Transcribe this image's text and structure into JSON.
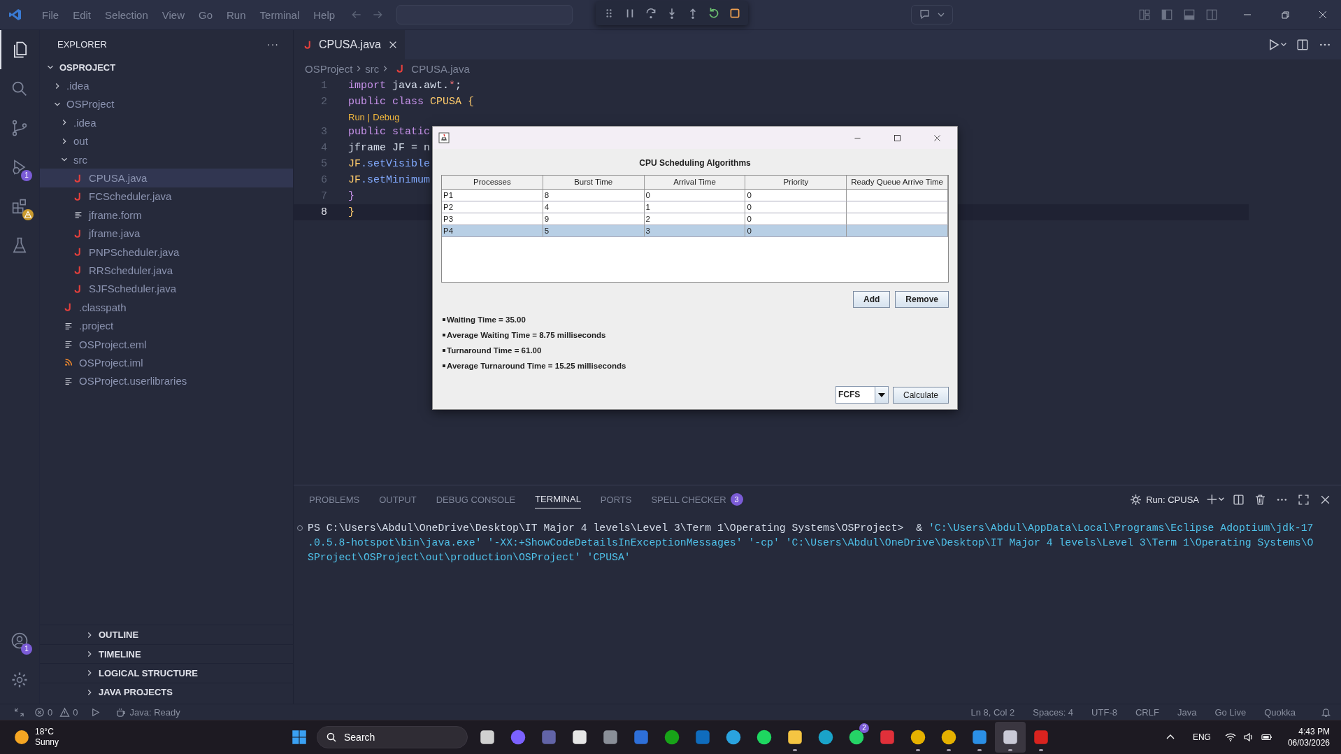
{
  "menu": [
    "File",
    "Edit",
    "Selection",
    "View",
    "Go",
    "Run",
    "Terminal",
    "Help"
  ],
  "activity": [
    {
      "kind": "files",
      "selected": true
    },
    {
      "kind": "search",
      "selected": false
    },
    {
      "kind": "branch",
      "selected": false
    },
    {
      "kind": "debug",
      "selected": false,
      "badge": "1"
    },
    {
      "kind": "extensions",
      "selected": false,
      "warning": true
    },
    {
      "kind": "flask",
      "selected": false
    }
  ],
  "activity_bottom": [
    {
      "kind": "account",
      "badge": "1"
    },
    {
      "kind": "gear"
    }
  ],
  "explorer": {
    "title": "EXPLORER",
    "menu": "···",
    "root": {
      "label": "OSPROJECT",
      "expanded": true,
      "children": [
        {
          "label": ".idea",
          "expanded": false,
          "selected": false
        },
        {
          "label": "OSProject",
          "expanded": true,
          "selected": false,
          "children": [
            {
              "label": ".idea",
              "expanded": false,
              "selected": false
            },
            {
              "label": "out",
              "expanded": false,
              "selected": false
            },
            {
              "label": "src",
              "expanded": true,
              "selected": false,
              "children": [
                {
                  "label": "CPUSA.java",
                  "kind": "java",
                  "selected": true
                },
                {
                  "label": "FCScheduler.java",
                  "kind": "java",
                  "selected": false
                },
                {
                  "label": "jframe.form",
                  "kind": "lines",
                  "selected": false
                },
                {
                  "label": "jframe.java",
                  "kind": "java",
                  "selected": false
                },
                {
                  "label": "PNPScheduler.java",
                  "kind": "java",
                  "selected": false
                },
                {
                  "label": "RRScheduler.java",
                  "kind": "java",
                  "selected": false
                },
                {
                  "label": "SJFScheduler.java",
                  "kind": "java",
                  "selected": false
                }
              ]
            },
            {
              "label": ".classpath",
              "kind": "java",
              "selected": false
            },
            {
              "label": ".project",
              "kind": "lines",
              "selected": false
            },
            {
              "label": "OSProject.eml",
              "kind": "lines",
              "selected": false
            },
            {
              "label": "OSProject.iml",
              "kind": "rss",
              "selected": false
            },
            {
              "label": "OSProject.userlibraries",
              "kind": "lines",
              "selected": false
            }
          ]
        }
      ]
    }
  },
  "sections": [
    {
      "label": "OUTLINE",
      "expanded": false
    },
    {
      "label": "TIMELINE",
      "expanded": false
    },
    {
      "label": "LOGICAL STRUCTURE",
      "expanded": false
    },
    {
      "label": "JAVA PROJECTS",
      "expanded": false
    }
  ],
  "editor": {
    "tab": "CPUSA.java",
    "breadcrumbs": [
      "OSProject",
      "src",
      "CPUSA.java"
    ],
    "lines": [
      {
        "num": "1",
        "current": false,
        "tokens": [
          {
            "t": "import",
            "kind": "keyword"
          },
          {
            "t": " java.awt.",
            "kind": "plain"
          },
          {
            "t": "*",
            "kind": "operator"
          },
          {
            "t": ";",
            "kind": "plain"
          }
        ]
      },
      {
        "num": "2",
        "current": false,
        "tokens": [
          {
            "t": "public class ",
            "kind": "keyword"
          },
          {
            "t": "CPUSA",
            "kind": "type"
          },
          {
            "t": " {",
            "kind": "type"
          }
        ],
        "lens": [
          "Run",
          "|",
          "Debug"
        ]
      },
      {
        "num": "3",
        "current": false,
        "tokens": [
          {
            "t": "public static",
            "kind": "keyword"
          }
        ]
      },
      {
        "num": "4",
        "current": false,
        "tokens": [
          {
            "t": "jframe JF = n",
            "kind": "plain"
          }
        ]
      },
      {
        "num": "5",
        "current": false,
        "tokens": [
          {
            "t": "JF",
            "kind": "type"
          },
          {
            "t": ".setVisible",
            "kind": "method"
          }
        ]
      },
      {
        "num": "6",
        "current": false,
        "tokens": [
          {
            "t": "JF",
            "kind": "type"
          },
          {
            "t": ".setMinimum",
            "kind": "method"
          }
        ]
      },
      {
        "num": "7",
        "current": false,
        "tokens": [
          {
            "t": "}",
            "kind": "keyword"
          }
        ]
      },
      {
        "num": "8",
        "current": true,
        "tokens": [
          {
            "t": "}",
            "kind": "type"
          }
        ]
      }
    ]
  },
  "dialog": {
    "heading": "CPU Scheduling Algorithms",
    "columns": [
      "Processes",
      "Burst Time",
      "Arrival Time",
      "Priority",
      "Ready Queue Arrive Time"
    ],
    "rows": [
      {
        "cells": [
          "P1",
          "8",
          "0",
          "0"
        ],
        "selected": false
      },
      {
        "cells": [
          "P2",
          "4",
          "1",
          "0"
        ],
        "selected": false
      },
      {
        "cells": [
          "P3",
          "9",
          "2",
          "0"
        ],
        "selected": false
      },
      {
        "cells": [
          "P4",
          "5",
          "3",
          "0"
        ],
        "selected": true
      }
    ],
    "buttons": [
      "Add",
      "Remove"
    ],
    "results": [
      "Waiting Time = 35.00",
      "Average Waiting Time = 8.75 milliseconds",
      "Turnaround Time = 61.00",
      "Average Turnaround Time = 15.25 milliseconds"
    ],
    "algorithm": "FCFS",
    "calculate": "Calculate"
  },
  "panel": {
    "tabs": [
      {
        "label": "PROBLEMS",
        "selected": false
      },
      {
        "label": "OUTPUT",
        "selected": false
      },
      {
        "label": "DEBUG CONSOLE",
        "selected": false
      },
      {
        "label": "TERMINAL",
        "selected": true
      },
      {
        "label": "PORTS",
        "selected": false
      },
      {
        "label": "SPELL CHECKER",
        "selected": false,
        "badge": "3"
      }
    ],
    "run_label": "Run: CPUSA",
    "terminal": [
      [
        {
          "t": "PS C:\\Users\\Abdul\\OneDrive\\Desktop\\IT Major 4 levels\\Level 3\\Term 1\\Operating Systems\\OSProject>  & ",
          "kind": "plain"
        },
        {
          "t": "'C:\\Users\\Abdul\\AppData\\Local\\Programs\\Eclipse Adoptium\\jdk-17",
          "kind": "string"
        }
      ],
      [
        {
          "t": ".0.5.8-hotspot\\bin\\java.exe' '-XX:+ShowCodeDetailsInExceptionMessages' '-cp' 'C:\\Users\\Abdul\\OneDrive\\Desktop\\IT Major 4 levels\\Level 3\\Term 1\\Operating Systems\\O",
          "kind": "string"
        }
      ],
      [
        {
          "t": "SProject\\OSProject\\out\\production\\OSProject' 'CPUSA'",
          "kind": "string"
        }
      ]
    ]
  },
  "status_bar": {
    "errors": "0",
    "warnings": "0",
    "java": "Java: Ready",
    "right": [
      "Ln 8, Col 2",
      "Spaces: 4",
      "UTF-8",
      "CRLF",
      "Java",
      "Go Live",
      "Quokka"
    ]
  },
  "taskbar": {
    "temp": "18°C",
    "weather": "Sunny",
    "search": "Search",
    "apps": [
      {
        "kind": "taskview",
        "running": false,
        "selected": false
      },
      {
        "kind": "copilot",
        "running": false,
        "selected": false
      },
      {
        "kind": "teams",
        "running": false,
        "selected": false
      },
      {
        "kind": "store",
        "running": false,
        "selected": false
      },
      {
        "kind": "hexagon",
        "running": false,
        "selected": false
      },
      {
        "kind": "stripes",
        "running": false,
        "selected": false
      },
      {
        "kind": "xbox",
        "running": false,
        "selected": false
      },
      {
        "kind": "mail",
        "running": false,
        "selected": false
      },
      {
        "kind": "plane",
        "running": false,
        "selected": false
      },
      {
        "kind": "waves",
        "running": false,
        "selected": false
      },
      {
        "kind": "folder",
        "running": true,
        "selected": false
      },
      {
        "kind": "edge",
        "running": false,
        "selected": false
      },
      {
        "kind": "chat",
        "running": false,
        "selected": false,
        "badge": "2"
      },
      {
        "kind": "camera",
        "running": false,
        "selected": false
      },
      {
        "kind": "chrome",
        "running": true,
        "selected": false
      },
      {
        "kind": "chrome",
        "running": true,
        "selected": false
      },
      {
        "kind": "code",
        "running": true,
        "selected": false
      },
      {
        "kind": "java",
        "running": true,
        "selected": true
      },
      {
        "kind": "pdf",
        "running": true,
        "selected": false
      }
    ],
    "lang": "ENG",
    "time": "4:43 PM",
    "date": "06/03/2026"
  }
}
